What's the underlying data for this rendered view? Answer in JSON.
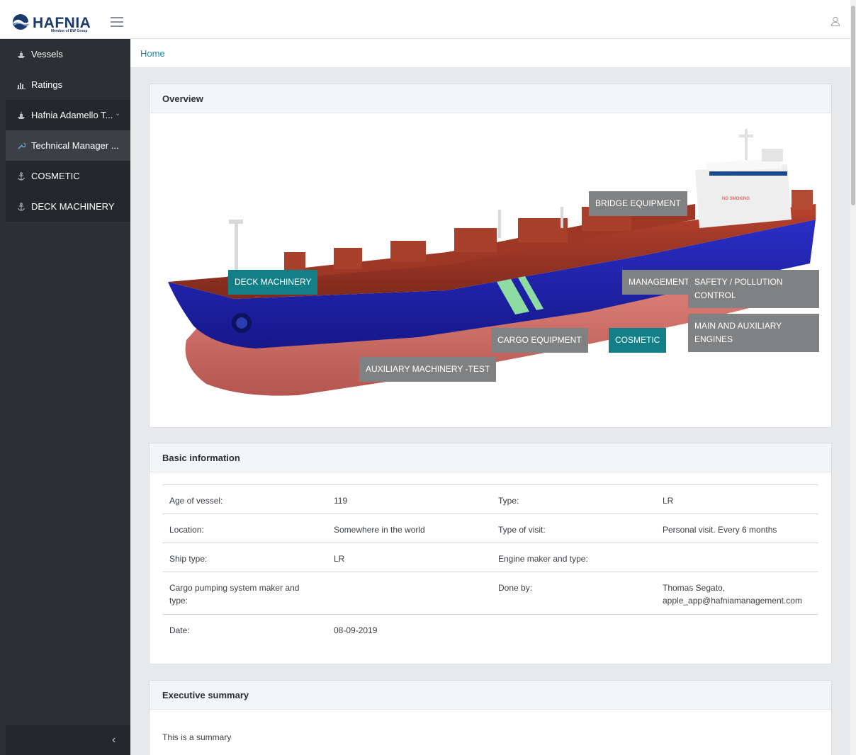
{
  "header": {
    "logo_text": "HAFNIA",
    "logo_subtitle": "Member of BW Group",
    "logo_icon": "hafnia-wave-logo",
    "menu_icon": "hamburger-icon",
    "user_icon": "user-icon"
  },
  "sidebar": {
    "items": [
      {
        "label": "Vessels",
        "icon": "ship-icon"
      },
      {
        "label": "Ratings",
        "icon": "bar-chart-icon"
      },
      {
        "label": "Hafnia Adamello T...",
        "icon": "ship-icon",
        "chevron": "⌄"
      },
      {
        "label": "Technical Manager ...",
        "icon": "wrench-icon"
      },
      {
        "label": "COSMETIC",
        "icon": "anchor-icon"
      },
      {
        "label": "DECK MACHINERY",
        "icon": "anchor-icon"
      }
    ],
    "collapse_glyph": "‹"
  },
  "breadcrumb": {
    "home": "Home"
  },
  "overview": {
    "title": "Overview",
    "hotspots": {
      "bridge": "BRIDGE EQUIPMENT",
      "deck": "DECK MACHINERY",
      "management": "MANAGEMENT",
      "safety": "SAFETY / POLLUTION CONTROL",
      "engines": "MAIN AND AUXILIARY ENGINES",
      "cargo": "CARGO EQUIPMENT",
      "cosmetic": "COSMETIC",
      "auxiliary": "AUXILIARY MACHINERY -TEST"
    },
    "ship_sign": "NO SMOKING"
  },
  "basic_info": {
    "title": "Basic information",
    "rows": [
      {
        "l1": "Age of vessel:",
        "v1": "119",
        "l2": "Type:",
        "v2": "LR"
      },
      {
        "l1": "Location:",
        "v1": "Somewhere in the world",
        "l2": "Type of visit:",
        "v2": "Personal visit. Every 6 months"
      },
      {
        "l1": "Ship type:",
        "v1": "LR",
        "l2": "Engine maker and type:",
        "v2": ""
      },
      {
        "l1": "Cargo pumping system maker and type:",
        "v1": "",
        "l2": "Done by:",
        "v2": "Thomas Segato, apple_app@hafniamanagement.com"
      },
      {
        "l1": "Date:",
        "v1": "08-09-2019",
        "l2": "",
        "v2": ""
      }
    ]
  },
  "executive_summary": {
    "title": "Executive summary",
    "text": "This is a summary"
  },
  "colors": {
    "sidebar_bg": "#2c3035",
    "accent_teal": "#127f86",
    "hotspot_gray": "#808182",
    "link": "#1f8a9e"
  }
}
